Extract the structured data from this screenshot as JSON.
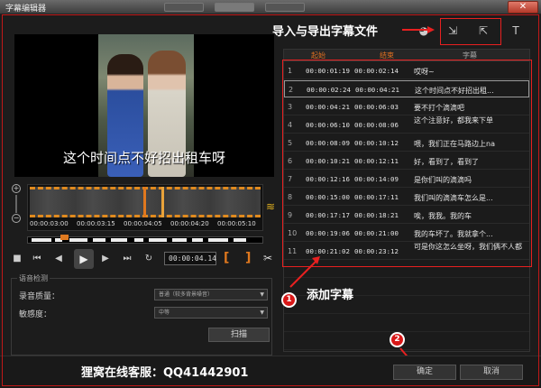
{
  "window": {
    "title": "字幕编辑器",
    "close_glyph": "✕"
  },
  "annotations": {
    "import_export": "导入与导出字幕文件",
    "add_subtitles": "添加字幕",
    "service": "狸窝在线客服：QQ41442901",
    "step1": "1",
    "step2": "2"
  },
  "video": {
    "caption": "这个时间点不好招出租车呀"
  },
  "timeline": {
    "ticks": [
      "00:00:03:00",
      "00:00:03:15",
      "00:00:04:05",
      "00:00:04:20",
      "00:00:05:10"
    ]
  },
  "transport": {
    "timecode": "00:00:04.14",
    "bracket_in": "[",
    "bracket_out": "]"
  },
  "voice": {
    "title": "语音检测",
    "quality_label": "录音质量：",
    "quality_value": "普通（较多背景噪音）",
    "sensitivity_label": "敏感度：",
    "sensitivity_value": "中等",
    "scan_label": "扫描"
  },
  "table": {
    "headers": {
      "start": "起始",
      "end": "结束",
      "text": "字幕"
    },
    "rows": [
      {
        "num": "1",
        "start": "00:00:01:19",
        "end": "00:00:02:14",
        "text": "哎呀~"
      },
      {
        "num": "2",
        "start": "00:00:02:24",
        "end": "00:00:04:21",
        "text": "这个时间点不好招出租..."
      },
      {
        "num": "3",
        "start": "00:00:04:21",
        "end": "00:00:06:03",
        "text": "要不打个滴滴吧"
      },
      {
        "num": "4",
        "start": "00:00:06:10",
        "end": "00:00:08:06",
        "text": "这个注意好，都我来下单"
      },
      {
        "num": "5",
        "start": "00:00:08:09",
        "end": "00:00:10:12",
        "text": "喂，我们正在马路边上na"
      },
      {
        "num": "6",
        "start": "00:00:10:21",
        "end": "00:00:12:11",
        "text": "好，看到了，看到了"
      },
      {
        "num": "7",
        "start": "00:00:12:16",
        "end": "00:00:14:09",
        "text": "是你们叫的滴滴吗"
      },
      {
        "num": "8",
        "start": "00:00:15:00",
        "end": "00:00:17:11",
        "text": "我们叫的滴滴车怎么是..."
      },
      {
        "num": "9",
        "start": "00:00:17:17",
        "end": "00:00:18:21",
        "text": "唉，我我。我的车"
      },
      {
        "num": "10",
        "start": "00:00:19:06",
        "end": "00:00:21:00",
        "text": "我的车坏了。我就拿个..."
      },
      {
        "num": "11",
        "start": "00:00:21:02",
        "end": "00:00:23:12",
        "text": "可是你这怎么坐呀，我们俩不人都"
      }
    ]
  },
  "buttons": {
    "ok": "确定",
    "cancel": "取消"
  },
  "colors": {
    "accent": "#e07020",
    "annotation_red": "#e82020"
  }
}
